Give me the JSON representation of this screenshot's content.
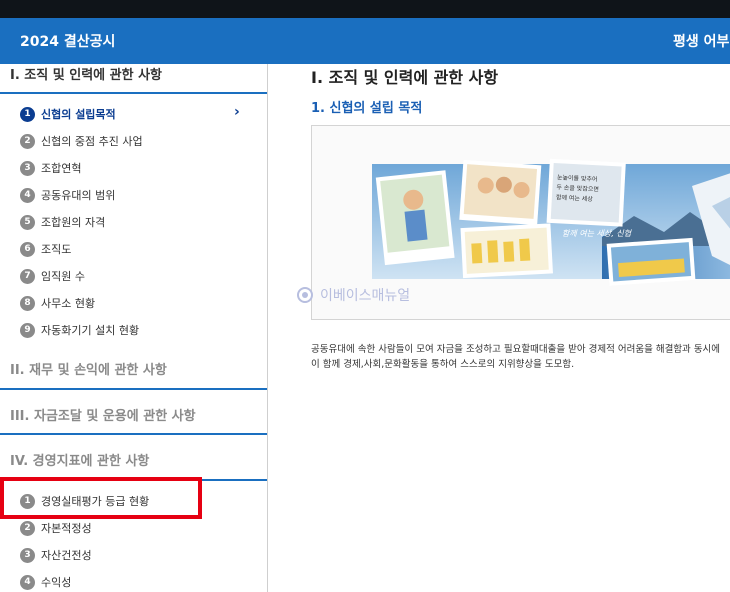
{
  "header": {
    "app_title": "2024 결산공시",
    "right_title": "평생 어부"
  },
  "sidebar": {
    "sections": [
      {
        "title": "I. 조직 및 인력에 관한 사항",
        "items": [
          {
            "num": "1",
            "label": "신협의 설립목적",
            "active": true
          },
          {
            "num": "2",
            "label": "신협의 중점 추진 사업"
          },
          {
            "num": "3",
            "label": "조합연혁"
          },
          {
            "num": "4",
            "label": "공동유대의 범위"
          },
          {
            "num": "5",
            "label": "조합원의 자격"
          },
          {
            "num": "6",
            "label": "조직도"
          },
          {
            "num": "7",
            "label": "임직원 수"
          },
          {
            "num": "8",
            "label": "사무소 현황"
          },
          {
            "num": "9",
            "label": "자동화기기 설치 현황"
          }
        ]
      },
      {
        "title": "II. 재무 및 손익에 관한 사항"
      },
      {
        "title": "III. 자금조달 및 운용에 관한 사항"
      },
      {
        "title": "IV. 경영지표에 관한 사항",
        "items": [
          {
            "num": "1",
            "label": "경영실태평가 등급 현황"
          },
          {
            "num": "2",
            "label": "자본적정성"
          },
          {
            "num": "3",
            "label": "자산건전성"
          },
          {
            "num": "4",
            "label": "수익성"
          }
        ]
      }
    ]
  },
  "main": {
    "title": "I. 조직 및 인력에 관한 사항",
    "subtitle": "1. 신협의 설립 목적",
    "banner_text": [
      "눈높이를 맞추어 듣고합니다",
      "두 손을 맞잡으면 든든합니다",
      "함께 여는 세상, 신협"
    ],
    "watermark": "이베이스매뉴얼",
    "description": [
      "공동유대에 속한 사람들이 모여 자금을 조성하고 필요할때대출을 받아 경제적 어려움을 해결함과 동시에",
      "이 함께 경제,사회,문화활동을 통하여 스스로의 지위향상을 도모함."
    ]
  },
  "colors": {
    "header_blue": "#1a6fc0",
    "active_navy": "#0b3d91",
    "highlight_red": "#e60012"
  }
}
